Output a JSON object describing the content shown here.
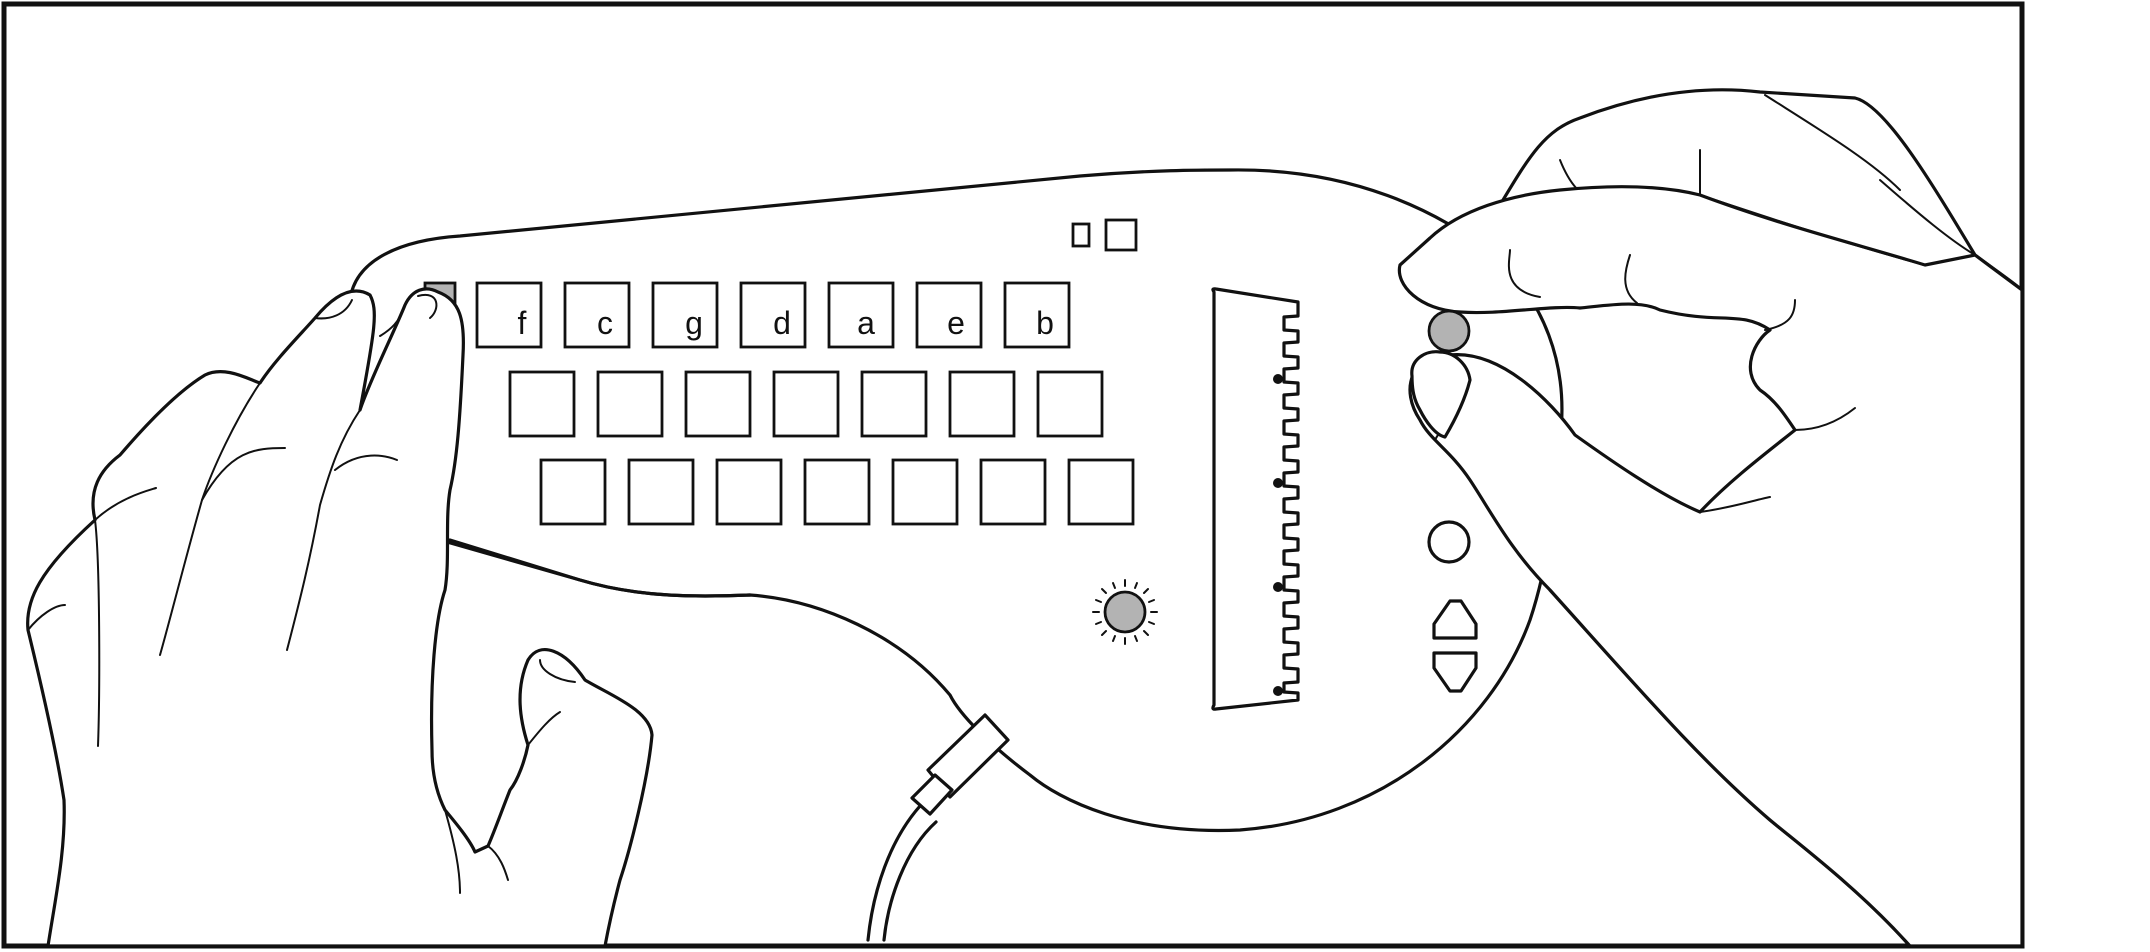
{
  "illustration": {
    "subject": "handheld-keyboard-device",
    "key_labels": [
      "f",
      "c",
      "g",
      "d",
      "a",
      "e",
      "b"
    ],
    "unlabeled_key_rows": 2,
    "keys_per_row": 7,
    "colors": {
      "outline": "#111111",
      "button_fill": "#b3b3b3",
      "background": "#ffffff"
    }
  }
}
